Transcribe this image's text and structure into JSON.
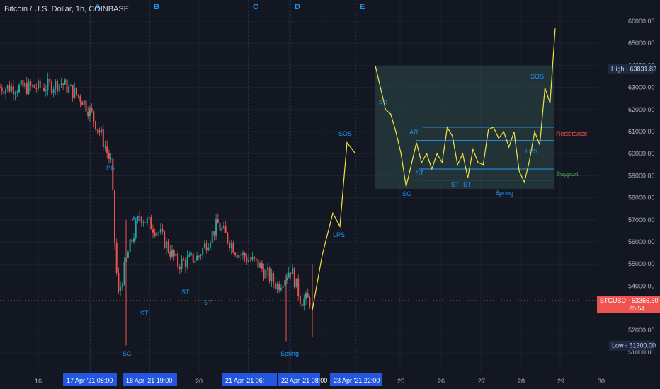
{
  "header": {
    "title": "Bitcoin / U.S. Dollar, 1h, COINBASE"
  },
  "price_axis": {
    "ticks": [
      "66000.00",
      "65000.00",
      "64000.00",
      "63000.00",
      "62000.00",
      "61000.00",
      "60000.00",
      "59000.00",
      "58000.00",
      "57000.00",
      "56000.00",
      "55000.00",
      "54000.00",
      "53000.00",
      "52000.00",
      "51000.00"
    ],
    "high_label": "High",
    "high_value": "63831.82",
    "low_label": "Low",
    "low_value": "51300.00",
    "last_symbol": "BTCUSD",
    "last_value": "53366.50",
    "countdown": "25:54"
  },
  "time_axis": {
    "labels": [
      "16",
      "20",
      "25",
      "26",
      "27",
      "28",
      "29",
      "30"
    ],
    "highlights": [
      "17 Apr '21   08:00",
      "18 Apr '21   19:00",
      "21 Apr '21   06:",
      "22 Apr '21   08:00",
      "23 Apr '21   22:00"
    ]
  },
  "phases": [
    "A",
    "B",
    "C",
    "D",
    "E"
  ],
  "colors": {
    "background": "#131722",
    "up_candle": "#26a69a",
    "down_candle": "#ef5350",
    "projection": "#f0e442",
    "label_blue": "#2196f3",
    "resistance": "#ef5350",
    "support": "#4caf50",
    "schematic_fill": "#2e4a48"
  },
  "chart_data": {
    "type": "line",
    "series": [
      {
        "name": "BTCUSD",
        "x": [
          "16 Apr 08:00",
          "16 Apr 20:00",
          "17 Apr 08:00",
          "17 Apr 14:00",
          "17 Apr 20:00",
          "18 Apr 02:00",
          "18 Apr 04:00",
          "18 Apr 06:00",
          "18 Apr 12:00",
          "18 Apr 19:00",
          "19 Apr 06:00",
          "19 Apr 18:00",
          "20 Apr 06:00",
          "20 Apr 18:00",
          "21 Apr 06:00",
          "21 Apr 18:00",
          "22 Apr 06:00",
          "22 Apr 14:00",
          "22 Apr 20:00"
        ],
        "y": [
          63000,
          63200,
          62500,
          61800,
          60800,
          59500,
          56000,
          53500,
          55500,
          57200,
          56500,
          55000,
          55300,
          56800,
          55500,
          55000,
          54000,
          54800,
          53366.5
        ]
      },
      {
        "name": "",
        "x": [
          "22 Apr 20:00",
          "23 Apr 02:00",
          "23 Apr 08:00",
          "23 Apr 16:00",
          "23 Apr 22:00",
          "24 Apr 04:00"
        ],
        "y": [
          52900,
          55400,
          57300,
          56700,
          60500,
          60000
        ]
      }
    ],
    "annotations": [
      {
        "text": "PS",
        "x": "17 Apr 18:00",
        "y": 59400
      },
      {
        "text": "AR",
        "x": "18 Apr 04:00",
        "y": 57000
      },
      {
        "text": "SC",
        "x": "18 Apr 03:00",
        "y": 51300
      },
      {
        "text": "ST",
        "x": "18 Apr 08:00",
        "y": 53200
      },
      {
        "text": "ST",
        "x": "19 Apr 18:00",
        "y": 54000
      },
      {
        "text": "ST",
        "x": "20 Apr 02:00",
        "y": 53600
      },
      {
        "text": "Spring",
        "x": "22 Apr 08:00",
        "y": 51300
      },
      {
        "text": "LPS",
        "x": "23 Apr 14:00",
        "y": 56500
      },
      {
        "text": "SOS",
        "x": "23 Apr 21:00",
        "y": 60800
      }
    ],
    "inset": {
      "zigzag_y": [
        64000,
        63000,
        62000,
        61800,
        61000,
        60000,
        58500,
        59500,
        60500,
        59600,
        60000,
        59300,
        60000,
        59600,
        61200,
        60800,
        59500,
        60000,
        58900,
        60200,
        59600,
        59500,
        61100,
        61200,
        60700,
        61000,
        60300,
        61000,
        59200,
        58700,
        59700,
        61000,
        60400,
        63000,
        62300,
        65700
      ],
      "labels": [
        {
          "text": "PS",
          "type": "event"
        },
        {
          "text": "SC",
          "type": "event"
        },
        {
          "text": "AR",
          "type": "event"
        },
        {
          "text": "ST",
          "type": "event"
        },
        {
          "text": "ST",
          "type": "event"
        },
        {
          "text": "ST",
          "type": "event"
        },
        {
          "text": "Spring",
          "type": "event"
        },
        {
          "text": "LPS",
          "type": "event"
        },
        {
          "text": "SOS",
          "type": "event"
        },
        {
          "text": "Resistance",
          "type": "level"
        },
        {
          "text": "Support",
          "type": "level"
        }
      ],
      "levels": {
        "resistance": [
          61200,
          60600
        ],
        "support": [
          59300,
          58800
        ]
      }
    },
    "ylim": [
      50500,
      66500
    ],
    "grid": true
  }
}
